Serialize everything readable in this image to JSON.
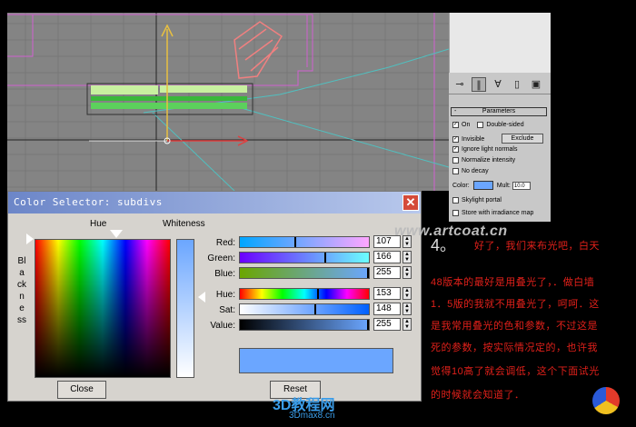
{
  "dialog": {
    "title": "Color Selector: subdivs",
    "close_glyph": "✕",
    "hue_label": "Hue",
    "whiteness_label": "Whiteness",
    "blackness_label": "Blackness",
    "sliders": [
      {
        "label": "Red:",
        "value": "107"
      },
      {
        "label": "Green:",
        "value": "166"
      },
      {
        "label": "Blue:",
        "value": "255"
      },
      {
        "label": "Hue:",
        "value": "153"
      },
      {
        "label": "Sat:",
        "value": "148"
      },
      {
        "label": "Value:",
        "value": "255"
      }
    ],
    "selected_color": "#6ba6ff",
    "close_button": "Close",
    "reset_button": "Reset"
  },
  "command_panel": {
    "rollout_title": "Parameters",
    "on_label": "On",
    "double_sided_label": "Double-sided",
    "invisible_label": "Invisible",
    "exclude_button": "Exclude",
    "ignore_normals_label": "Ignore light normals",
    "normalize_label": "Normalize intensity",
    "no_decay_label": "No decay",
    "color_label": "Color:",
    "mult_label": "Mult:",
    "mult_value": "10.0",
    "skylight_label": "Skylight portal",
    "store_label": "Store with irradiance map"
  },
  "watermark": "www.artcoat.cn",
  "tutorial": {
    "step_number": "4。",
    "lines": [
      "好了，我们来布光吧，白天",
      "48版本的最好是用叠光了，．做白墙",
      "1．5版的我就不用叠光了，呵呵．这",
      "是我常用叠光的色和参数，不过这是",
      "死的参数，按实际情况定的，也许我",
      "觉得10高了就会调低，这个下面试光",
      "的时候就会知道了．"
    ]
  },
  "footer_logo": {
    "main": "3D教程网",
    "sub": "3Dmax8.cn"
  }
}
